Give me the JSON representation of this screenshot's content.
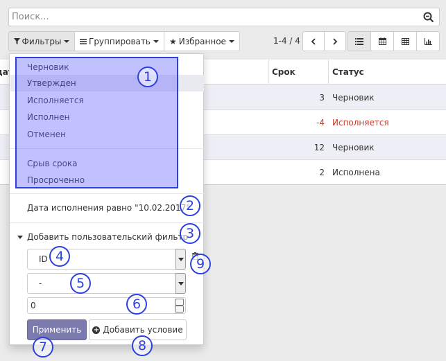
{
  "search": {
    "placeholder": "Поиск..."
  },
  "toolbar": {
    "filters_label": "Фильтры",
    "group_label": "Группировать",
    "favorites_label": "Избранное",
    "pager": "1-4 / 4"
  },
  "list": {
    "headers": {
      "date_partial": "дат",
      "deadline": "Срок",
      "status": "Статус"
    },
    "rows": [
      {
        "days": "3",
        "status": "Черновик",
        "late": false
      },
      {
        "days": "-4",
        "status": "Исполняется",
        "late": true
      },
      {
        "days": "12",
        "status": "Черновик",
        "late": false
      },
      {
        "days": "2",
        "status": "Исполнена",
        "late": false
      }
    ]
  },
  "filters_menu": {
    "status_items": [
      "Черновик",
      "Утвержден",
      "Исполняется",
      "Исполнен",
      "Отменен"
    ],
    "deadline_items": [
      "Срыв срока",
      "Просроченно"
    ],
    "custom_date_filter": "Дата исполнения равно \"10.02.2017\"",
    "add_custom_label": "Добавить пользовательский фильтр",
    "field_select_value": "ID",
    "operator_select_value": "-",
    "value_input": "0",
    "apply_label": "Применить",
    "add_condition_label": "Добавить условие"
  },
  "markers": [
    "1",
    "2",
    "3",
    "4",
    "5",
    "6",
    "7",
    "8",
    "9"
  ],
  "colors": {
    "accent": "#7c7bad",
    "highlight_border": "#2a40e0",
    "late": "#c0392b"
  }
}
